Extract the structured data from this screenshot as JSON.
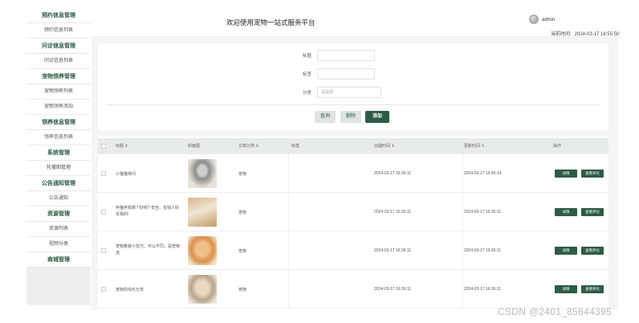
{
  "header": {
    "site_title": "欢迎使用宠物一站式服务平台",
    "username": "admin",
    "time_label": "当前时间:",
    "time_value": "2024-03-17 16:55:50"
  },
  "sidebar": {
    "groups": [
      {
        "title": "预约信息管理",
        "items": [
          "预约信息列表"
        ]
      },
      {
        "title": "问诊信息管理",
        "items": [
          "问诊信息列表"
        ]
      },
      {
        "title": "宠物领养管理",
        "items": [
          "宠物领养列表",
          "宠物领养添加"
        ]
      },
      {
        "title": "领养信息管理",
        "items": [
          "领养信息列表"
        ]
      },
      {
        "title": "系统管理",
        "items": [
          "轮播图管理"
        ]
      },
      {
        "title": "公告通知管理",
        "items": [
          "公告通知"
        ]
      },
      {
        "title": "资源管理",
        "items": [
          "资源列表",
          "视频分类"
        ]
      },
      {
        "title": "商城管理",
        "items": []
      }
    ]
  },
  "search": {
    "title_label": "标题",
    "title_value": "",
    "tag_label": "标签",
    "tag_value": "",
    "category_label": "分类",
    "category_placeholder": "请选择",
    "query_btn": "查询",
    "delete_btn": "删除",
    "add_btn": "添加"
  },
  "table": {
    "columns": [
      "标题 ⇕",
      "封面图",
      "文章分类 ⇕",
      "标签",
      "创建时间 ⇕",
      "更新时间 ⇕",
      "操作"
    ],
    "row_actions": [
      "详情",
      "查看评论"
    ],
    "rows": [
      {
        "title": "小猫猫常问",
        "category": "宠物",
        "tag": "",
        "created": "2024-03-17 16:36:11",
        "updated": "2024-03-17 16:45:14",
        "actions": [
          "详情",
          "查看评论"
        ]
      },
      {
        "title": "养猫养狗那个好呢? 安全、省钱人好贸易的!",
        "category": "宠物",
        "tag": "",
        "created": "2024-03-17 16:36:11",
        "updated": "2024-03-17 16:36:11",
        "actions": [
          "详情",
          "查看评论"
        ]
      },
      {
        "title": "宠物着装小技巧，可以不同，是宠物迷",
        "category": "宠物",
        "tag": "",
        "created": "2024-03-17 16:36:11",
        "updated": "2024-03-17 16:36:11",
        "actions": [
          "详情",
          "查看评论"
        ]
      },
      {
        "title": "宠物的快乐分享",
        "category": "宠物",
        "tag": "",
        "created": "2024-03-17 16:36:11",
        "updated": "2024-03-17 16:36:11",
        "actions": [
          "详情",
          "查看评论"
        ]
      }
    ]
  },
  "watermark": "CSDN @2401_85644395",
  "colors": {
    "accent": "#2d5c45",
    "sidebar_bg": "#efeff2",
    "table_head": "#e7ebea"
  }
}
